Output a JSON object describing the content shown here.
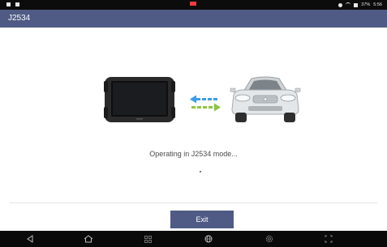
{
  "status_bar": {
    "time": "5:56",
    "battery": "37%"
  },
  "header": {
    "title": "J2534"
  },
  "main": {
    "status_text": "Operating in J2534 mode..."
  },
  "footer": {
    "exit_label": "Exit"
  },
  "colors": {
    "accent": "#4f5b85",
    "arrow_blue": "#3c9ee6",
    "arrow_green": "#8cc63f"
  },
  "nav_icons": [
    "back-icon",
    "home-icon",
    "apps-icon",
    "browser-icon",
    "settings-icon",
    "screenshot-icon"
  ]
}
